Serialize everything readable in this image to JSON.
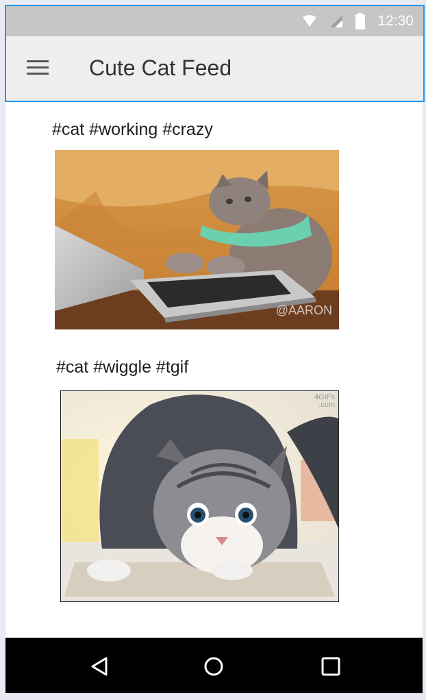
{
  "status_bar": {
    "time": "12:30",
    "icons": [
      "wifi-icon",
      "signal-icon",
      "battery-icon"
    ]
  },
  "toolbar": {
    "menu_icon": "hamburger-menu-icon",
    "title": "Cute Cat Feed"
  },
  "feed": {
    "posts": [
      {
        "caption": "#cat #working #crazy",
        "image_watermark": "@AARON"
      },
      {
        "caption": "#cat #wiggle #tgif",
        "image_watermark": "4GIFs\n.com"
      }
    ]
  },
  "nav_bar": {
    "buttons": [
      "back-triangle-icon",
      "home-circle-icon",
      "recents-square-icon"
    ]
  },
  "colors": {
    "status_bar": "#c6c6c6",
    "toolbar": "#eeeeee",
    "selection_border": "#2196f3",
    "nav_bar": "#000000"
  }
}
